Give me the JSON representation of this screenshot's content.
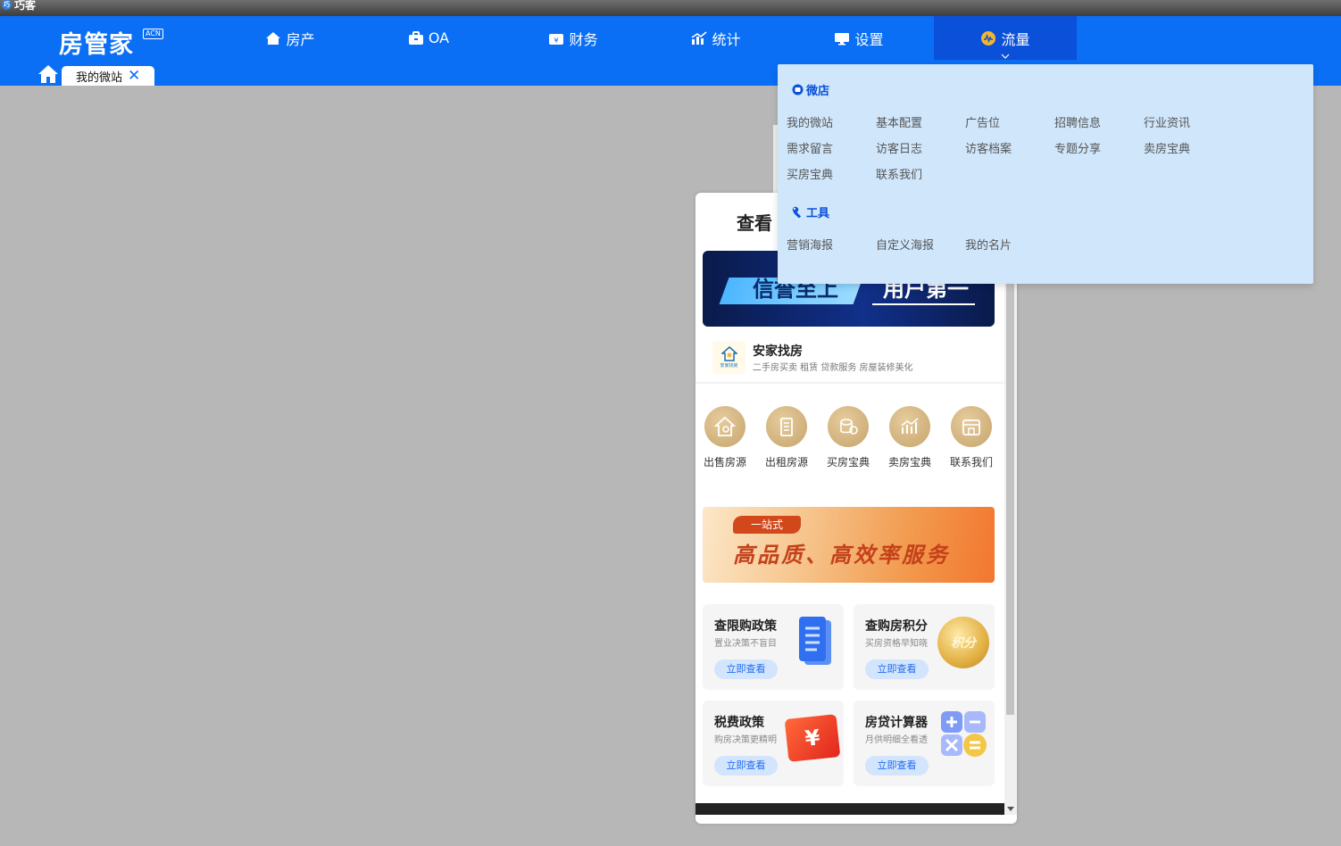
{
  "window": {
    "title": "巧客"
  },
  "logo": {
    "text": "房管家",
    "badge": "ACN"
  },
  "nav": {
    "items": [
      {
        "label": "房产",
        "icon": "house-icon"
      },
      {
        "label": "OA",
        "icon": "briefcase-icon"
      },
      {
        "label": "财务",
        "icon": "wallet-icon"
      },
      {
        "label": "统计",
        "icon": "chart-icon"
      },
      {
        "label": "设置",
        "icon": "monitor-icon"
      },
      {
        "label": "流量",
        "icon": "traffic-icon"
      }
    ],
    "active": "流量"
  },
  "tabs": [
    {
      "label": "我的微站",
      "close": "✕"
    }
  ],
  "dropdown": {
    "sections": [
      {
        "title": "微店",
        "items": [
          "我的微站",
          "基本配置",
          "广告位",
          "招聘信息",
          "行业资讯",
          "需求留言",
          "访客日志",
          "访客档案",
          "专题分享",
          "卖房宝典",
          "买房宝典",
          "联系我们"
        ]
      },
      {
        "title": "工具",
        "items": [
          "营销海报",
          "自定义海报",
          "我的名片"
        ]
      }
    ]
  },
  "preview": {
    "title": "查看",
    "banner1": {
      "left": "信誉至上",
      "right": "用户第一"
    },
    "brand": {
      "logo_text": "安家找房",
      "name": "安家找房",
      "desc": "二手房买卖 租赁 贷款服务 房屋装修美化"
    },
    "quick": [
      "出售房源",
      "出租房源",
      "买房宝典",
      "卖房宝典",
      "联系我们"
    ],
    "banner2": {
      "tag": "一站式",
      "text": "高品质、高效率服务"
    },
    "cards": [
      {
        "title": "查限购政策",
        "desc": "置业决策不盲目",
        "button": "立即查看"
      },
      {
        "title": "查购房积分",
        "desc": "买房资格早知晓",
        "button": "立即查看",
        "badge": "积分"
      },
      {
        "title": "税费政策",
        "desc": "购房决策更精明",
        "button": "立即查看",
        "badge": "¥"
      },
      {
        "title": "房贷计算器",
        "desc": "月供明细全看透",
        "button": "立即查看"
      }
    ]
  },
  "colors": {
    "primary": "#0a6ff5",
    "active_nav": "#0a50d8",
    "dropdown_bg": "#cfe6fb",
    "page_bg": "#b7b7b7",
    "quick_icon": "#c6a46c"
  }
}
